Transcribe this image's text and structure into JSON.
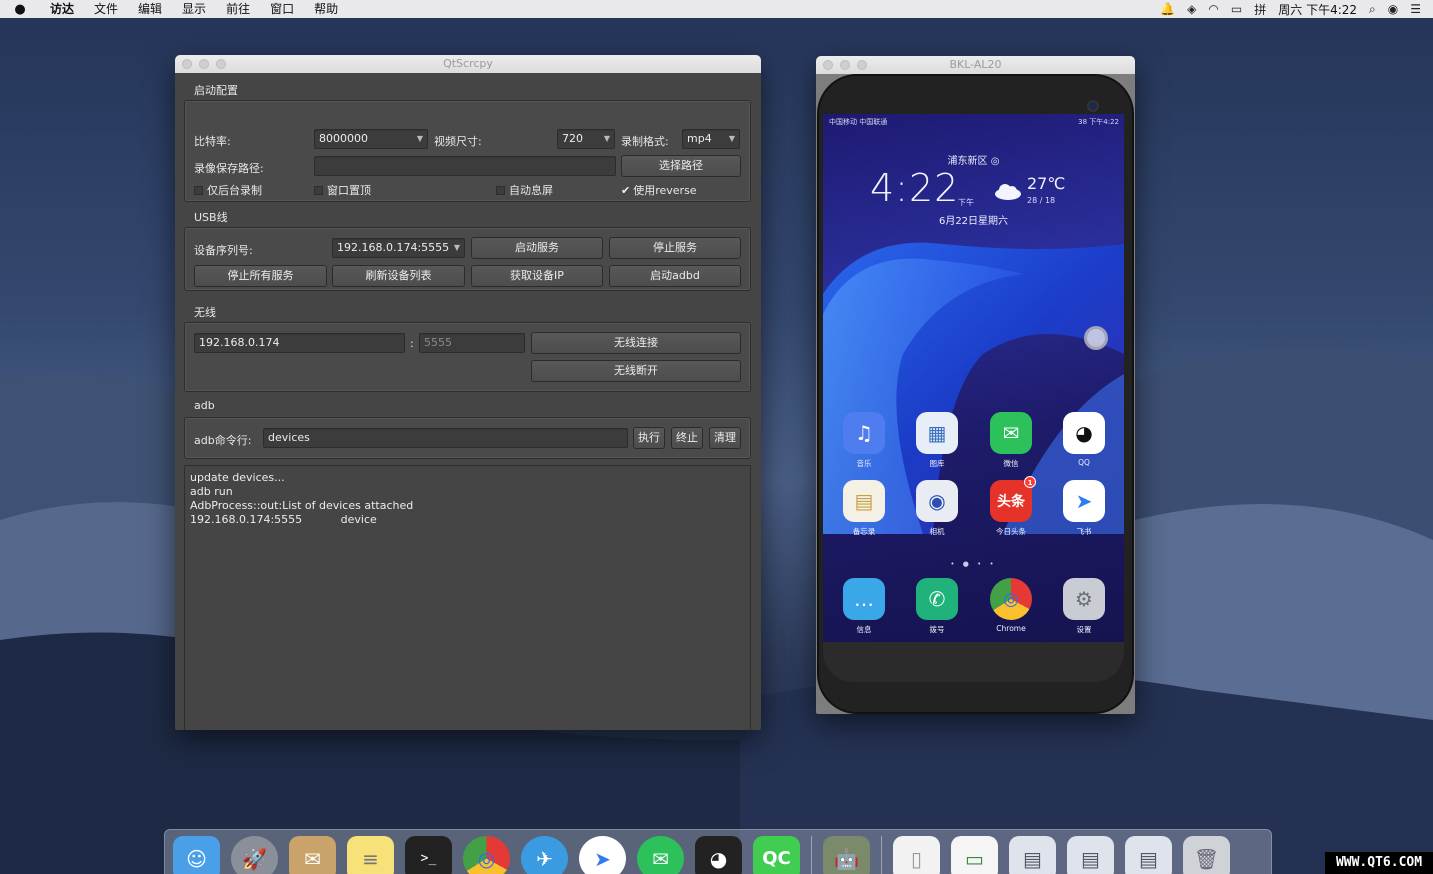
{
  "menubar": {
    "apple_icon": "apple-icon",
    "items": [
      "访达",
      "文件",
      "编辑",
      "显示",
      "前往",
      "窗口",
      "帮助"
    ],
    "status_icons": [
      "bell-icon",
      "shield-icon",
      "wifi-icon",
      "battery-icon"
    ],
    "input_method": "拼",
    "clock": "周六 下午4:22"
  },
  "qt": {
    "title": "QtScrcpy",
    "start_config": {
      "section": "启动配置",
      "bitrate_label": "比特率:",
      "bitrate_value": "8000000",
      "size_label": "视频尺寸:",
      "size_value": "720",
      "format_label": "录制格式:",
      "format_value": "mp4",
      "record_path_label": "录像保存路径:",
      "record_path_value": "",
      "select_path_button": "选择路径",
      "bg_record": "仅后台录制",
      "always_top": "窗口置顶",
      "close_screen": "自动息屏",
      "use_reverse": "使用reverse"
    },
    "usb": {
      "section": "USB线",
      "serial_label": "设备序列号:",
      "serial_value": "192.168.0.174:5555",
      "start_service": "启动服务",
      "stop_service": "停止服务",
      "stop_all": "停止所有服务",
      "refresh_devices": "刷新设备列表",
      "get_ip": "获取设备IP",
      "start_adbd": "启动adbd"
    },
    "wireless": {
      "section": "无线",
      "ip_value": "192.168.0.174",
      "colon": ":",
      "port_placeholder": "5555",
      "connect": "无线连接",
      "disconnect": "无线断开"
    },
    "adb": {
      "section": "adb",
      "cmd_label": "adb命令行:",
      "cmd_value": "devices",
      "execute": "执行",
      "terminate": "终止",
      "clear": "清理"
    },
    "console_lines": [
      "update devices...",
      "adb run",
      "AdbProcess::out:List of devices attached",
      "192.168.0.174:5555           device"
    ]
  },
  "phone": {
    "window_title": "BKL-AL20",
    "status_left": "中国移动 中国联通",
    "status_right": "38 下午4:22",
    "location": "浦东新区",
    "time": "4:22",
    "ampm": "下午",
    "temperature": "27℃",
    "temp_range": "28 / 18",
    "date": "6月22日星期六",
    "apps": [
      {
        "name": "音乐",
        "icon": "music-icon",
        "color": "#4f7df0",
        "glyph": "♫"
      },
      {
        "name": "图库",
        "icon": "gallery-icon",
        "color": "#e8eef7",
        "glyph": "▦"
      },
      {
        "name": "微信",
        "icon": "wechat-icon",
        "color": "#2dc15b",
        "glyph": "✉"
      },
      {
        "name": "QQ",
        "icon": "qq-icon",
        "color": "#ffffff",
        "glyph": "◕"
      },
      {
        "name": "备忘录",
        "icon": "notes-icon",
        "color": "#f4f0e6",
        "glyph": "▤"
      },
      {
        "name": "相机",
        "icon": "camera-icon",
        "color": "#e9edf3",
        "glyph": "◉"
      },
      {
        "name": "今日头条",
        "icon": "toutiao-icon",
        "color": "#e5332a",
        "glyph": "头条"
      },
      {
        "name": "飞书",
        "icon": "feishu-icon",
        "color": "#ffffff",
        "glyph": "➤"
      },
      {
        "name": "信息",
        "icon": "messages-icon",
        "color": "#3aa7e8",
        "glyph": "…"
      },
      {
        "name": "拨号",
        "icon": "phone-icon",
        "color": "#1fb37b",
        "glyph": "✆"
      },
      {
        "name": "Chrome",
        "icon": "chrome-icon",
        "color": "#ffffff",
        "glyph": "◎"
      },
      {
        "name": "设置",
        "icon": "settings-icon",
        "color": "#c9ccd3",
        "glyph": "⚙"
      }
    ],
    "toutiao_badge": "1",
    "page_dots": "• ● • •"
  },
  "dock": {
    "items": [
      {
        "icon": "finder-icon",
        "color": "#4aa0e8",
        "glyph": "☺"
      },
      {
        "icon": "launchpad-icon",
        "color": "#8a8f99",
        "glyph": "🚀"
      },
      {
        "icon": "mail-icon",
        "color": "#c9a36a",
        "glyph": "✉"
      },
      {
        "icon": "notes-icon",
        "color": "#f7e27a",
        "glyph": "≡"
      },
      {
        "icon": "terminal-icon",
        "color": "#222222",
        "glyph": ">_"
      },
      {
        "icon": "chrome-icon",
        "color": "#ffffff",
        "glyph": "◎"
      },
      {
        "icon": "bird-app-icon",
        "color": "#3a9be0",
        "glyph": "✈"
      },
      {
        "icon": "feishu-icon",
        "color": "#ffffff",
        "glyph": "➤"
      },
      {
        "icon": "wechat-icon",
        "color": "#2dc15b",
        "glyph": "✉"
      },
      {
        "icon": "qq-icon",
        "color": "#222222",
        "glyph": "◕"
      },
      {
        "icon": "qtcreator-icon",
        "color": "#41cd52",
        "glyph": "QC"
      },
      {
        "icon": "android-icon",
        "color": "#7a8a6a",
        "glyph": "🤖"
      },
      {
        "icon": "document-icon",
        "color": "#f2f2f2",
        "glyph": "▯"
      },
      {
        "icon": "preview-icon",
        "color": "#f5f5f5",
        "glyph": "▭"
      },
      {
        "icon": "screenshot-icon",
        "color": "#dfe4ec",
        "glyph": "▤"
      },
      {
        "icon": "screenshot-icon",
        "color": "#dfe4ec",
        "glyph": "▤"
      },
      {
        "icon": "screenshot-icon",
        "color": "#dfe4ec",
        "glyph": "▤"
      },
      {
        "icon": "trash-icon",
        "color": "#cfd3d8",
        "glyph": "🗑"
      }
    ]
  },
  "watermark": "WWW.QT6.COM"
}
